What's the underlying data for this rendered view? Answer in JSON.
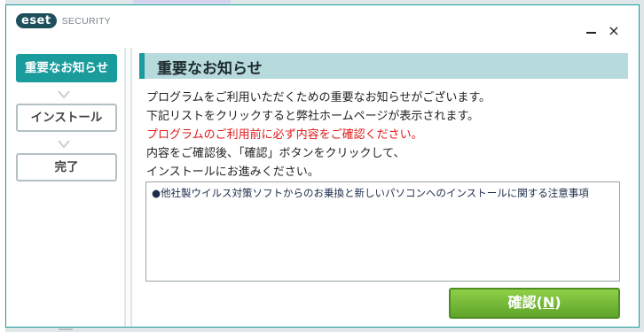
{
  "app": {
    "brand": "eset",
    "product": "SECURITY"
  },
  "window_controls": {
    "minimize_label": "–",
    "close_label": "×"
  },
  "steps": [
    {
      "label": "重要なお知らせ",
      "state": "active"
    },
    {
      "label": "インストール",
      "state": "inactive"
    },
    {
      "label": "完了",
      "state": "inactive"
    }
  ],
  "main": {
    "title": "重要なお知らせ",
    "lines": [
      "プログラムをご利用いただくための重要なお知らせがございます。",
      "下記リストをクリックすると弊社ホームページが表示されます。",
      "プログラムのご利用前に必ず内容をご確認ください。",
      "内容をご確認後、「確認」ボタンをクリックして、",
      "インストールにお進みください。"
    ],
    "notice_items": [
      "●他社製ウイルス対策ソフトからのお乗換と新しいパソコンへのインストールに関する注意事項"
    ],
    "confirm_label": "確認(",
    "confirm_key": "N",
    "confirm_label_end": ")"
  },
  "colors": {
    "accent": "#1a9c9d",
    "title_bg": "#b7dadc",
    "warning_text": "#e01a1a",
    "confirm_green": "#6cb833"
  }
}
